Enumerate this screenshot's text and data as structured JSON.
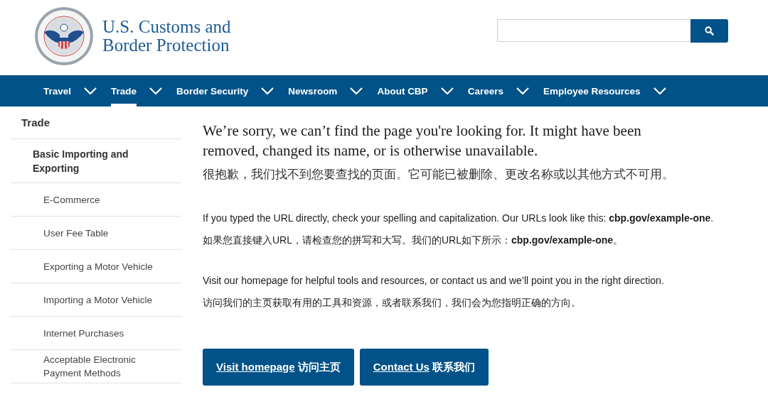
{
  "header": {
    "agency_name": [
      "U.S. Customs and",
      "Border Protection"
    ]
  },
  "nav": [
    {
      "label": "Travel",
      "selected": false
    },
    {
      "label": "Trade",
      "selected": true
    },
    {
      "label": "Border Security",
      "selected": false
    },
    {
      "label": "Newsroom",
      "selected": false
    },
    {
      "label": "About CBP",
      "selected": false
    },
    {
      "label": "Careers",
      "selected": false
    },
    {
      "label": "Employee Resources",
      "selected": false
    }
  ],
  "sidebar": {
    "title": "Trade",
    "items": [
      {
        "label": "Basic Importing and Exporting",
        "children": [
          {
            "label": "E-Commerce"
          },
          {
            "label": "User Fee Table"
          },
          {
            "label": "Exporting a Motor Vehicle"
          },
          {
            "label": "Importing a Motor Vehicle"
          },
          {
            "label": "Internet Purchases"
          },
          {
            "label": "Acceptable Electronic Payment Methods"
          }
        ]
      }
    ]
  },
  "content": {
    "heading": "We’re sorry, we can’t find the page you're looking for. It might have been removed, changed its name, or is otherwise unavailable.",
    "heading_zh": "很抱歉，我们找不到您要查找的页面。它可能已被删除、更改名称或以其他方式不可用。",
    "paragraphs": [
      "If you typed the URL directly, check your spelling and capitalization. Our URLs look like this: **cbp.gov/example-one**.",
      "如果您直接键入URL，请检查您的拼写和大写。我们的URL如下所示：**cbp.gov/example-one**。",
      "Visit our homepage for helpful tools and resources, or contact us and we’ll point you in the right direction.",
      "访问我们的主页获取有用的工具和资源，或者联系我们，我们会为您指明正确的方向。"
    ],
    "buttons": [
      {
        "link": "Visit homepage",
        "text": "访问主页"
      },
      {
        "link": "Contact Us",
        "text": "联系我们"
      }
    ]
  }
}
